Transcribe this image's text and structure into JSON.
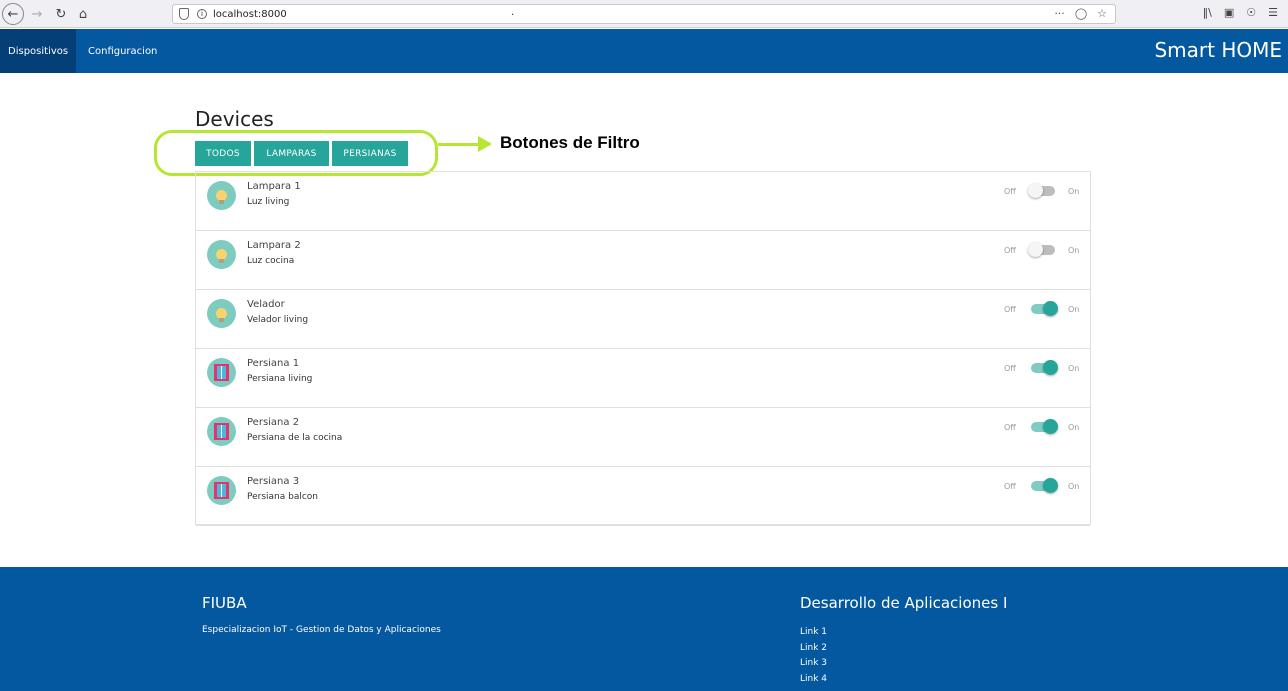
{
  "browser": {
    "url": "localhost:8000",
    "nav": {
      "back_icon": "arrow-left-icon",
      "forward_icon": "arrow-right-icon",
      "reload_icon": "reload-icon",
      "home_icon": "home-icon"
    },
    "url_dot": ".",
    "url_actions": "···"
  },
  "header": {
    "tabs": [
      {
        "label": "Dispositivos",
        "active": true
      },
      {
        "label": "Configuracion",
        "active": false
      }
    ],
    "brand": "Smart HOME",
    "color": "#0458a0"
  },
  "main": {
    "title": "Devices",
    "filters": [
      {
        "label": "TODOS"
      },
      {
        "label": "LAMPARAS"
      },
      {
        "label": "PERSIANAS"
      }
    ],
    "annotation": "Botones de Filtro",
    "accent": "#26a69a",
    "highlight_color": "#b7e534",
    "devices": [
      {
        "name": "Lampara 1",
        "description": "Luz living",
        "type": "lamp",
        "icon": "lightbulb-icon",
        "off_label": "Off",
        "on_label": "On",
        "state": false
      },
      {
        "name": "Lampara 2",
        "description": "Luz cocina",
        "type": "lamp",
        "icon": "lightbulb-icon",
        "off_label": "Off",
        "on_label": "On",
        "state": false
      },
      {
        "name": "Velador",
        "description": "Velador living",
        "type": "lamp",
        "icon": "lightbulb-icon",
        "off_label": "Off",
        "on_label": "On",
        "state": true
      },
      {
        "name": "Persiana 1",
        "description": "Persiana living",
        "type": "blind",
        "icon": "window-blind-icon",
        "off_label": "Off",
        "on_label": "On",
        "state": true
      },
      {
        "name": "Persiana 2",
        "description": "Persiana de la cocina",
        "type": "blind",
        "icon": "window-blind-icon",
        "off_label": "Off",
        "on_label": "On",
        "state": true
      },
      {
        "name": "Persiana 3",
        "description": "Persiana balcon",
        "type": "blind",
        "icon": "window-blind-icon",
        "off_label": "Off",
        "on_label": "On",
        "state": true
      }
    ]
  },
  "footer": {
    "left_title": "FIUBA",
    "left_text": "Especializacion IoT - Gestion de Datos y Aplicaciones",
    "right_title": "Desarrollo de Aplicaciones I",
    "links": [
      "Link 1",
      "Link 2",
      "Link 3",
      "Link 4"
    ]
  }
}
